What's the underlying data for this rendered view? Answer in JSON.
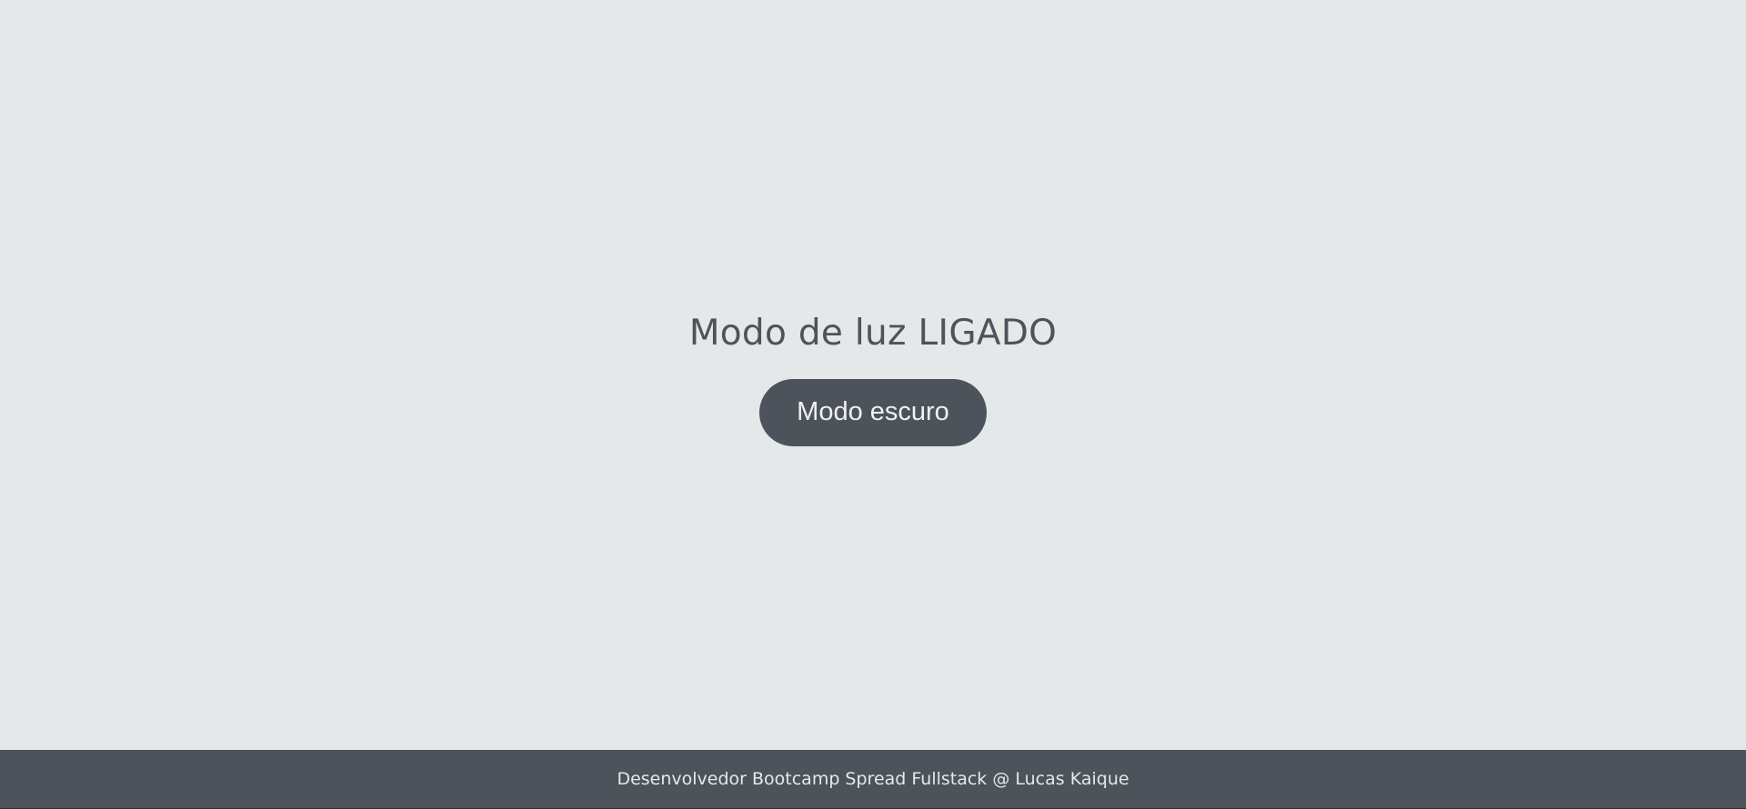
{
  "main": {
    "title": "Modo de luz LIGADO",
    "toggle_label": "Modo escuro"
  },
  "footer": {
    "text": "Desenvolvedor Bootcamp Spread Fullstack @ Lucas Kaique"
  },
  "colors": {
    "background": "#e4e8e9",
    "accent": "#4d535b",
    "button_text": "#f0f1f2"
  }
}
